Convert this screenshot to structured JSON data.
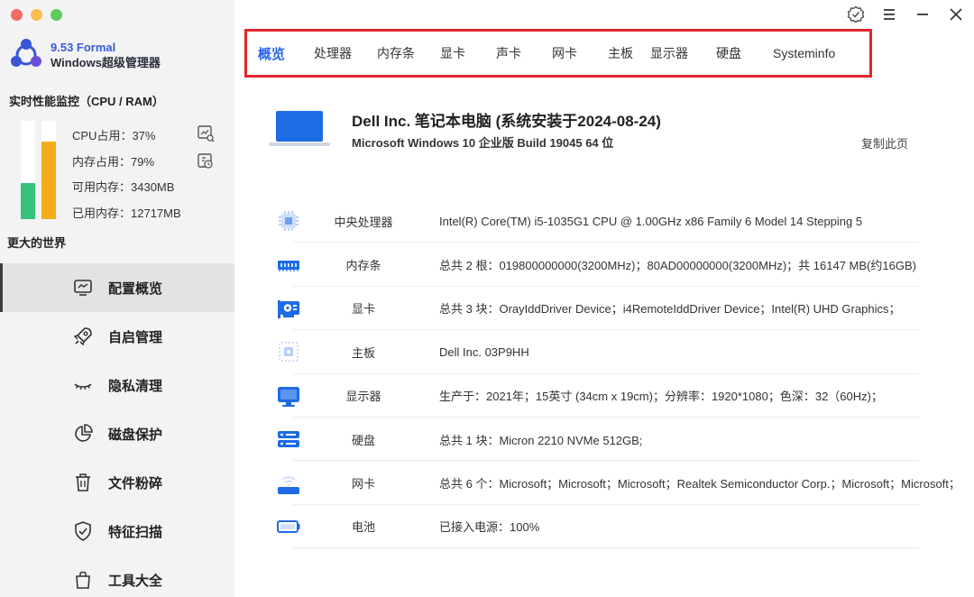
{
  "app": {
    "version": "9.53 Formal",
    "name": "Windows超级管理器"
  },
  "monitor": {
    "title": "实时性能监控（CPU / RAM）",
    "cpu_percent": 37,
    "mem_percent": 79,
    "cpu_text": "CPU占用：37%",
    "mem_text": "内存占用：79%",
    "avail_text": "可用内存：3430MB",
    "used_text": "已用内存：12717MB"
  },
  "world_label": "更大的世界",
  "nav": {
    "items": [
      {
        "label": "配置概览",
        "icon": "monitor-chart-icon",
        "active": true
      },
      {
        "label": "自启管理",
        "icon": "rocket-icon",
        "active": false
      },
      {
        "label": "隐私清理",
        "icon": "eye-closed-icon",
        "active": false
      },
      {
        "label": "磁盘保护",
        "icon": "pie-chart-icon",
        "active": false
      },
      {
        "label": "文件粉碎",
        "icon": "trash-icon",
        "active": false
      },
      {
        "label": "特征扫描",
        "icon": "shield-check-icon",
        "active": false
      },
      {
        "label": "工具大全",
        "icon": "bag-icon",
        "active": false
      }
    ]
  },
  "tabs": [
    "概览",
    "处理器",
    "内存条",
    "显卡",
    "声卡",
    "网卡",
    "主板",
    "显示器",
    "硬盘",
    "Systeminfo"
  ],
  "active_tab": 0,
  "header": {
    "title": "Dell Inc.  笔记本电脑 (系统安装于2024-08-24)",
    "os": "Microsoft Windows 10 企业版 Build 19045 64 位",
    "copy_label": "复制此页"
  },
  "specs": [
    {
      "label": "中央处理器",
      "value": "Intel(R) Core(TM) i5-1035G1 CPU @ 1.00GHz x86 Family 6 Model 14 Stepping 5",
      "icon": "cpu-icon"
    },
    {
      "label": "内存条",
      "value": "总共 2 根：019800000000(3200MHz)；80AD00000000(3200MHz)；共 16147 MB(约16GB)",
      "icon": "ram-icon"
    },
    {
      "label": "显卡",
      "value": "总共 3 块：OrayIddDriver Device；i4RemoteIddDriver Device；Intel(R) UHD Graphics；",
      "icon": "gpu-icon"
    },
    {
      "label": "主板",
      "value": "Dell Inc.  03P9HH",
      "icon": "motherboard-icon"
    },
    {
      "label": "显示器",
      "value": "生产于：2021年；15英寸 (34cm x 19cm)；分辨率：1920*1080；色深：32（60Hz)；",
      "icon": "display-icon"
    },
    {
      "label": "硬盘",
      "value": "总共 1 块：Micron 2210 NVMe 512GB;",
      "icon": "disk-icon"
    },
    {
      "label": "网卡",
      "value": "总共 6 个：Microsoft；Microsoft；Microsoft；Realtek Semiconductor Corp.；Microsoft；Microsoft；",
      "icon": "network-icon"
    },
    {
      "label": "电池",
      "value": "已接入电源：100%",
      "icon": "battery-icon"
    }
  ],
  "colors": {
    "accent": "#2a64e8",
    "cpu_bar": "#35c17e",
    "mem_bar": "#f4ad1a",
    "tab_highlight_border": "#e1262a",
    "icon_blue": "#1e6be6"
  }
}
